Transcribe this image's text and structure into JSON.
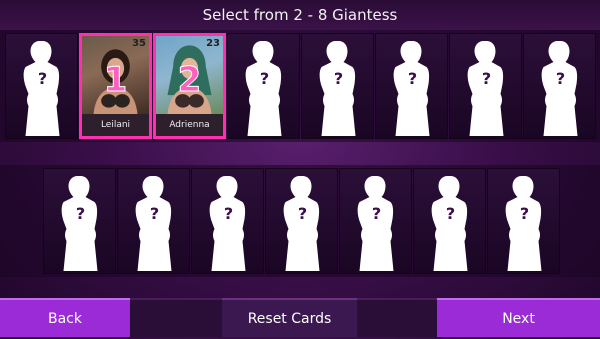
{
  "header": {
    "title": "Select from 2 - 8 Giantess"
  },
  "top_row": [
    {
      "state": "locked"
    },
    {
      "state": "selected",
      "order": "1",
      "level": "35",
      "name": "Leilani"
    },
    {
      "state": "selected",
      "order": "2",
      "level": "23",
      "name": "Adrienna"
    },
    {
      "state": "locked"
    },
    {
      "state": "locked"
    },
    {
      "state": "locked"
    },
    {
      "state": "locked"
    },
    {
      "state": "locked"
    }
  ],
  "bottom_row": [
    {
      "state": "locked"
    },
    {
      "state": "locked"
    },
    {
      "state": "locked"
    },
    {
      "state": "locked"
    },
    {
      "state": "locked"
    },
    {
      "state": "locked"
    },
    {
      "state": "locked"
    }
  ],
  "footer": {
    "back_label": "Back",
    "reset_label": "Reset Cards",
    "next_label": "Next"
  },
  "colors": {
    "accent": "#9b2bd6",
    "selected_border": "#ff2fb0",
    "background": "#3a0f4a"
  },
  "icons": {
    "locked_card": "silhouette-question-icon"
  }
}
